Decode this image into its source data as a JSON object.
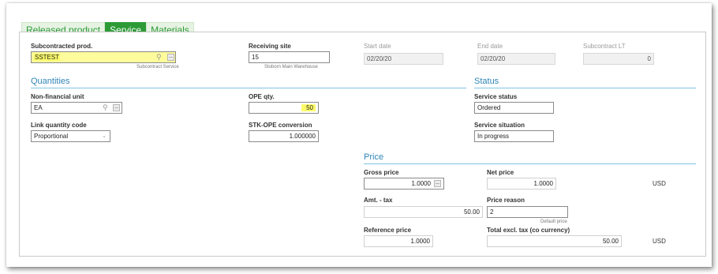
{
  "tabs": [
    {
      "label": "Released product",
      "active": false
    },
    {
      "label": "Service",
      "active": true
    },
    {
      "label": "Materials",
      "active": false
    }
  ],
  "fields": {
    "subcontracted_prod": {
      "label": "Subcontracted prod.",
      "value": "SSTEST",
      "hint": "Subcontract Service"
    },
    "receiving_site": {
      "label": "Receiving site",
      "value": "15",
      "hint": "Stoborn Main Warehouse"
    },
    "start_date": {
      "label": "Start date",
      "value": "02/20/20"
    },
    "end_date": {
      "label": "End date",
      "value": "02/20/20"
    },
    "subcontract_lt": {
      "label": "Subcontract LT",
      "value": "0"
    }
  },
  "quantities": {
    "title": "Quantities",
    "non_financial_unit": {
      "label": "Non-financial unit",
      "value": "EA"
    },
    "ope_qty": {
      "label": "OPE qty.",
      "value": "50"
    },
    "link_quantity_code": {
      "label": "Link quantity code",
      "value": "Proportional"
    },
    "stk_ope_conversion": {
      "label": "STK-OPE conversion",
      "value": "1.000000"
    }
  },
  "status": {
    "title": "Status",
    "service_status": {
      "label": "Service status",
      "value": "Ordered"
    },
    "service_situation": {
      "label": "Service situation",
      "value": "In progress"
    }
  },
  "price": {
    "title": "Price",
    "gross_price": {
      "label": "Gross price",
      "value": "1.0000"
    },
    "net_price": {
      "label": "Net price",
      "value": "1.0000",
      "currency": "USD"
    },
    "amt_tax": {
      "label": "Amt. - tax",
      "value": "50.00"
    },
    "price_reason": {
      "label": "Price reason",
      "value": "2",
      "hint": "Default price"
    },
    "reference_price": {
      "label": "Reference price",
      "value": "1.0000"
    },
    "total_excl_tax": {
      "label": "Total excl. tax (co currency)",
      "value": "50.00",
      "currency": "USD"
    }
  },
  "icons": {
    "lookup": "magnifier-icon",
    "table": "table-icon",
    "dropdown": "chevron-down-icon"
  },
  "colors": {
    "tab_green": "#2c9a36",
    "tab_light": "#e6f3e3",
    "section_blue": "#2f86b7",
    "highlight_yellow": "#fdfb9b"
  }
}
